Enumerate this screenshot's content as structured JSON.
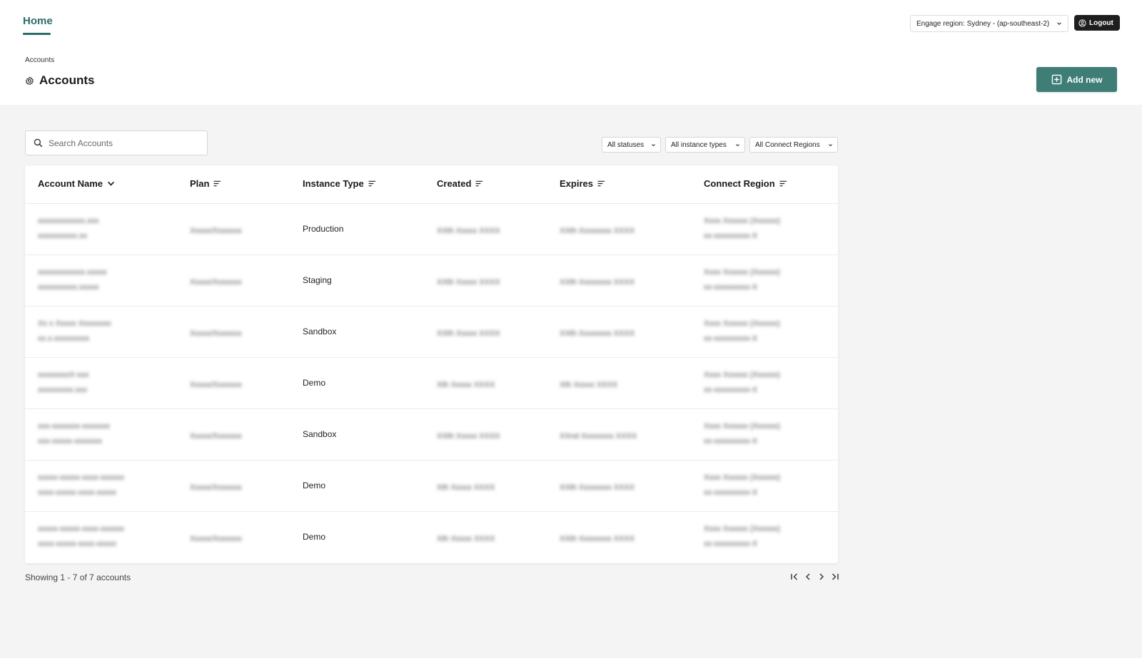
{
  "nav": {
    "home_label": "Home"
  },
  "header": {
    "region_label": "Engage region: Sydney - (ap-southeast-2)",
    "logout_label": "Logout"
  },
  "breadcrumb": "Accounts",
  "page_title": "Accounts",
  "add_button_label": "Add new",
  "search": {
    "placeholder": "Search Accounts",
    "value": ""
  },
  "filters": {
    "status": "All statuses",
    "instance_type": "All instance types",
    "connect_region": "All Connect Regions"
  },
  "table": {
    "columns": [
      "Account Name",
      "Plan",
      "Instance Type",
      "Created",
      "Expires",
      "Connect Region"
    ],
    "rows": [
      {
        "name_line1": "xxxxxxxxxxxx.xxx",
        "name_line2": "xxxxxxxxxx.xx",
        "plan": "Xxxxx/Xxxxxxx",
        "instance_type": "Production",
        "created": "XXth Xxxxx XXXX",
        "expires": "XXth Xxxxxxxx XXXX",
        "region_line1": "Xxxx Xxxxxx (Xxxxxx)",
        "region_line2": "xx-xxxxxxxxx-X"
      },
      {
        "name_line1": "xxxxxxxxxxxx.xxxxx",
        "name_line2": "xxxxxxxxxx.xxxxx",
        "plan": "Xxxxx/Xxxxxxx",
        "instance_type": "Staging",
        "created": "XXth Xxxxx XXXX",
        "expires": "XXth Xxxxxxxx XXXX",
        "region_line1": "Xxxx Xxxxxx (Xxxxxx)",
        "region_line2": "xx-xxxxxxxxx-X"
      },
      {
        "name_line1": "Xx x Xxxxx Xxxxxxxx",
        "name_line2": "xx.x.xxxxxxxxx",
        "plan": "Xxxxx/Xxxxxxx",
        "instance_type": "Sandbox",
        "created": "XXth Xxxxx XXXX",
        "expires": "XXth Xxxxxxxx XXXX",
        "region_line1": "Xxxx Xxxxxx (Xxxxxx)",
        "region_line2": "xx-xxxxxxxxx-X"
      },
      {
        "name_line1": "xxxxxxxxX-xxx",
        "name_line2": "xxxxxxxxx.xxx",
        "plan": "Xxxxx/Xxxxxxx",
        "instance_type": "Demo",
        "created": "Xth Xxxxx XXXX",
        "expires": "Xth Xxxxx XXXX",
        "region_line1": "Xxxx Xxxxxx (Xxxxxx)",
        "region_line2": "xx-xxxxxxxxx-X"
      },
      {
        "name_line1": "xxx-xxxxxxx-xxxxxxx",
        "name_line2": "xxx-xxxxx-xxxxxxx",
        "plan": "Xxxxx/Xxxxxxx",
        "instance_type": "Sandbox",
        "created": "XXth Xxxxx XXXX",
        "expires": "XXnd Xxxxxxxx XXXX",
        "region_line1": "Xxxx Xxxxxx (Xxxxxx)",
        "region_line2": "xx-xxxxxxxxx-X"
      },
      {
        "name_line1": "xxxxx-xxxxx-xxxx-xxxxxx",
        "name_line2": "xxxx-xxxxx-xxxx-xxxxx",
        "plan": "Xxxxx/Xxxxxxx",
        "instance_type": "Demo",
        "created": "Xth Xxxxx XXXX",
        "expires": "XXth Xxxxxxxx XXXX",
        "region_line1": "Xxxx Xxxxxx (Xxxxxx)",
        "region_line2": "xx-xxxxxxxxx-X"
      },
      {
        "name_line1": "xxxxx-xxxxx-xxxx-xxxxxx",
        "name_line2": "xxxx-xxxxx-xxxx-xxxxx",
        "plan": "Xxxxx/Xxxxxxx",
        "instance_type": "Demo",
        "created": "Xth Xxxxx XXXX",
        "expires": "XXth Xxxxxxxx XXXX",
        "region_line1": "Xxxx Xxxxxx (Xxxxxx)",
        "region_line2": "xx-xxxxxxxxx-X"
      }
    ]
  },
  "footer": {
    "showing": "Showing 1 - 7 of 7 accounts"
  },
  "colors": {
    "accent": "#2d6b68",
    "button": "#3f7d77",
    "dark": "#1e1e1e",
    "background": "#f3f4f3"
  },
  "icons": {
    "settings": "gear-icon",
    "search": "search-icon",
    "add": "plus-square-icon",
    "logout": "user-circle-icon",
    "sort": "sort-lines-icon"
  }
}
